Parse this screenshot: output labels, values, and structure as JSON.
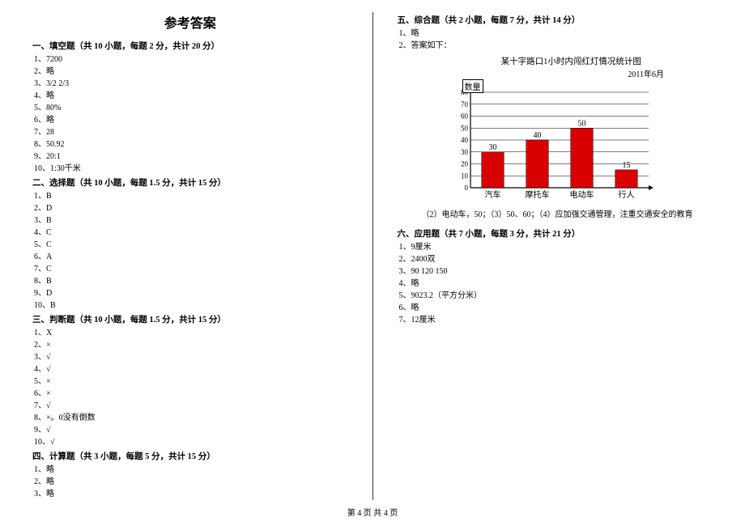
{
  "title": "参考答案",
  "col_left": {
    "sec1": {
      "header": "一、填空题（共 10 小题，每题 2 分，共计 20 分）",
      "items": [
        "1、7200",
        "2、略",
        "3、3/2    2/3",
        "4、略",
        "5、80%",
        "6、略",
        "7、28",
        "8、50.92",
        "9、20:1",
        "10、1:30千米"
      ]
    },
    "sec2": {
      "header": "二、选择题（共 10 小题，每题 1.5 分，共计 15 分）",
      "items": [
        "1、B",
        "2、D",
        "3、B",
        "4、C",
        "5、C",
        "6、A",
        "7、C",
        "8、B",
        "9、D",
        "10、B"
      ]
    },
    "sec3": {
      "header": "三、判断题（共 10 小题，每题 1.5 分，共计 15 分）",
      "items": [
        "1、X",
        "2、×",
        "3、√",
        "4、√",
        "5、×",
        "6、×",
        "7、√",
        "8、×。0没有倒数",
        "9、√",
        "10、√"
      ]
    },
    "sec4": {
      "header": "四、计算题（共 3 小题，每题 5 分，共计 15 分）",
      "items": [
        "1、略",
        "2、略",
        "3、略"
      ]
    }
  },
  "col_right": {
    "sec5": {
      "header": "五、综合题（共 2 小题，每题 7 分，共计 14 分）",
      "items": [
        "1、略",
        "2、答案如下："
      ],
      "chart_title": "某十字路口1小时内闯红灯情况统计图",
      "chart_date": "2011年6月",
      "axis_label": "数量",
      "caption": "（2）电动车，50；（3）50、60；（4）应加强交通管理，注重交通安全的教育"
    },
    "sec6": {
      "header": "六、应用题（共 7 小题，每题 3 分，共计 21 分）",
      "items": [
        "1、9厘米",
        "2、2400双",
        "3、90  120  150",
        "4、略",
        "5、9023.2（平方分米）",
        "6、略",
        "7、12厘米"
      ]
    }
  },
  "chart_data": {
    "type": "bar",
    "categories": [
      "汽车",
      "摩托车",
      "电动车",
      "行人"
    ],
    "values": [
      30,
      40,
      50,
      15
    ],
    "ylabel": "数量",
    "ylim": [
      0,
      80
    ],
    "yticks": [
      0,
      10,
      20,
      30,
      40,
      50,
      60,
      70,
      80
    ]
  },
  "footer": "第 4 页  共 4 页"
}
